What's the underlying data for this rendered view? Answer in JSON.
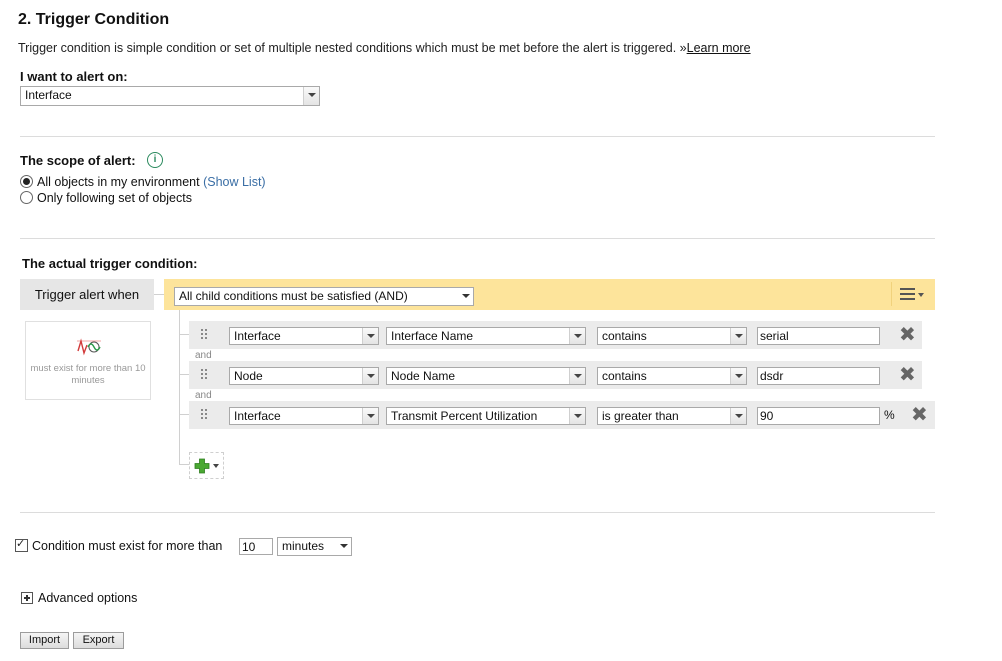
{
  "section": {
    "title": "2. Trigger Condition",
    "description": "Trigger condition is simple condition or set of multiple nested conditions which must be met before the alert is triggered. »",
    "learn_more": "Learn more"
  },
  "alert_on": {
    "label": "I want to alert on:",
    "value": "Interface"
  },
  "scope": {
    "label": "The scope of alert:",
    "info_icon": "info-icon",
    "options": [
      {
        "label": "All objects in my environment",
        "link": "(Show List)",
        "selected": true
      },
      {
        "label": "Only following set of objects",
        "selected": false
      }
    ]
  },
  "trigger": {
    "label": "The actual trigger condition:",
    "trigger_when": "Trigger alert when",
    "group_mode": "All child conditions must be satisfied (AND)",
    "menu_icon": "hamburger-menu-icon",
    "time_box_caption": "must exist for more than 10 minutes",
    "conditions": [
      {
        "object": "Interface",
        "field": "Interface Name",
        "operator": "contains",
        "value": "serial",
        "unit": ""
      },
      {
        "object": "Node",
        "field": "Node Name",
        "operator": "contains",
        "value": "dsdr",
        "unit": ""
      },
      {
        "object": "Interface",
        "field": "Transmit Percent Utilization",
        "operator": "is greater than",
        "value": "90",
        "unit": "%"
      }
    ],
    "connector": "and",
    "add_icon": "add-condition-icon"
  },
  "duration": {
    "checked": true,
    "label": "Condition must exist for more than",
    "value": "10",
    "unit": "minutes"
  },
  "advanced": {
    "label": "Advanced options"
  },
  "buttons": {
    "import": "Import",
    "export": "Export"
  },
  "colors": {
    "highlight": "#fde49b",
    "link": "#3a6ea5",
    "add_icon": "#4aa832",
    "wave_icon": "#d23b3b"
  }
}
